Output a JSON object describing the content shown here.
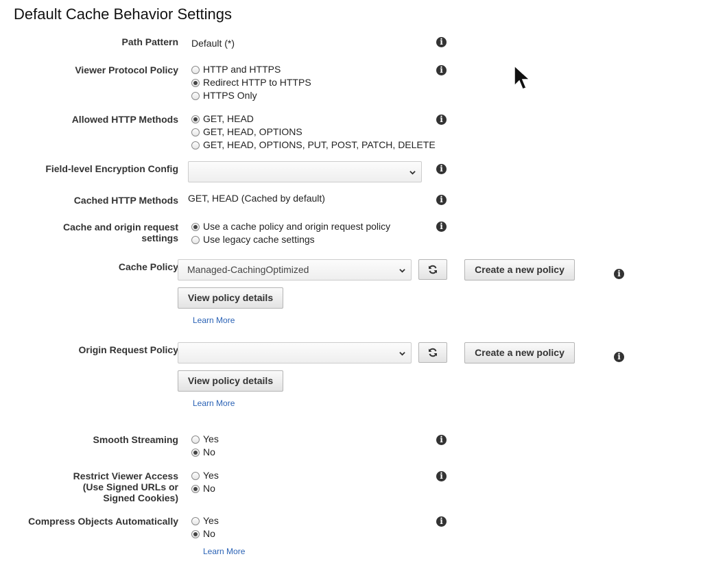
{
  "title": "Default Cache Behavior Settings",
  "path_pattern": {
    "label": "Path Pattern",
    "value": "Default (*)"
  },
  "viewer_protocol": {
    "label": "Viewer Protocol Policy",
    "options": [
      "HTTP and HTTPS",
      "Redirect HTTP to HTTPS",
      "HTTPS Only"
    ],
    "selected": "Redirect HTTP to HTTPS"
  },
  "allowed_methods": {
    "label": "Allowed HTTP Methods",
    "options": [
      "GET, HEAD",
      "GET, HEAD, OPTIONS",
      "GET, HEAD, OPTIONS, PUT, POST, PATCH, DELETE"
    ],
    "selected": "GET, HEAD"
  },
  "field_encryption": {
    "label": "Field-level Encryption Config",
    "value": ""
  },
  "cached_methods": {
    "label": "Cached HTTP Methods",
    "value": "GET, HEAD (Cached by default)"
  },
  "cache_origin": {
    "label_line1": "Cache and origin request",
    "label_line2": "settings",
    "options": [
      "Use a cache policy and origin request policy",
      "Use legacy cache settings"
    ],
    "selected": "Use a cache policy and origin request policy"
  },
  "cache_policy": {
    "label": "Cache Policy",
    "value": "Managed-CachingOptimized",
    "create_label": "Create a new policy",
    "details_label": "View policy details",
    "learn_more": "Learn More"
  },
  "origin_policy": {
    "label": "Origin Request Policy",
    "value": "",
    "create_label": "Create a new policy",
    "details_label": "View policy details",
    "learn_more": "Learn More"
  },
  "smooth_streaming": {
    "label": "Smooth Streaming",
    "options": [
      "Yes",
      "No"
    ],
    "selected": "No"
  },
  "restrict_viewer": {
    "label_line1": "Restrict Viewer Access",
    "label_line2": "(Use Signed URLs or",
    "label_line3": "Signed Cookies)",
    "options": [
      "Yes",
      "No"
    ],
    "selected": "No"
  },
  "compress": {
    "label": "Compress Objects Automatically",
    "options": [
      "Yes",
      "No"
    ],
    "selected": "No",
    "learn_more": "Learn More"
  },
  "icons": {
    "info": "info-icon",
    "refresh": "refresh-icon",
    "dropdown": "chevron-down-icon",
    "cursor": "mouse-cursor-icon"
  }
}
